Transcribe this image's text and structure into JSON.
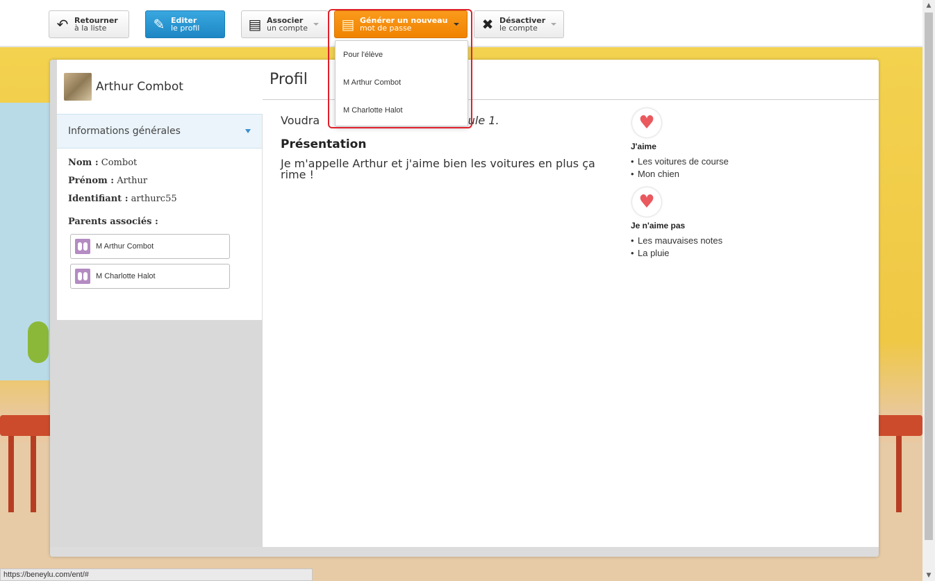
{
  "toolbar": {
    "back": {
      "line1": "Retourner",
      "line2": "à la liste",
      "icon": "undo-icon"
    },
    "edit": {
      "line1": "Editer",
      "line2": "le profil",
      "icon": "pencil-icon"
    },
    "associate": {
      "line1": "Associer",
      "line2": "un compte",
      "icon": "document-icon"
    },
    "generate": {
      "line1": "Générer un nouveau",
      "line2": "mot de passe",
      "icon": "document-icon"
    },
    "deactivate": {
      "line1": "Désactiver",
      "line2": "le compte",
      "icon": "close-icon"
    }
  },
  "dropdown": {
    "items": [
      "Pour l'élève",
      "M Arthur Combot",
      "M Charlotte Halot"
    ]
  },
  "sidebar": {
    "student_name": "Arthur Combot",
    "section_title": "Informations générales",
    "fields": {
      "nom_label": "Nom :",
      "nom_value": "Combot",
      "prenom_label": "Prénom :",
      "prenom_value": "Arthur",
      "id_label": "Identifiant :",
      "id_value": "arthurc55"
    },
    "parents_title": "Parents associés :",
    "parents": [
      "M Arthur Combot",
      "M Charlotte Halot"
    ]
  },
  "content": {
    "title": "Profil",
    "motto_start": "Voudra",
    "motto_end": "formule 1.",
    "presentation_title": "Présentation",
    "presentation_text": "Je m'appelle Arthur et j'aime bien les voitures en plus ça rime !",
    "likes_title": "J'aime",
    "likes": [
      "Les voitures de course",
      "Mon chien"
    ],
    "dislikes_title": "Je n'aime pas",
    "dislikes": [
      "Les mauvaises notes",
      "La pluie"
    ]
  },
  "status_url": "https://beneylu.com/ent/#",
  "colors": {
    "accent_blue": "#1d87c4",
    "accent_orange": "#f08300",
    "highlight_red": "#e0202a",
    "heart": "#e9595e"
  }
}
